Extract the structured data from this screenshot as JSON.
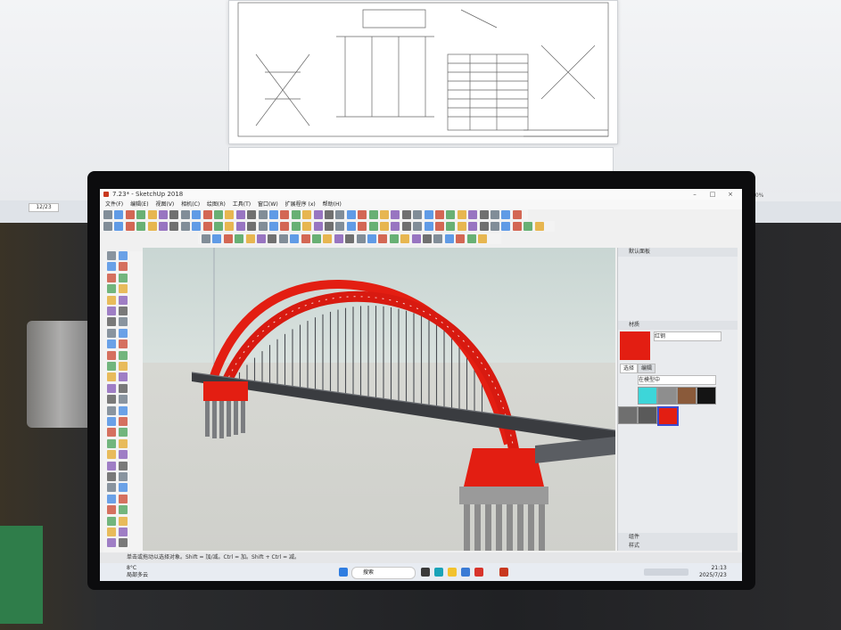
{
  "app": {
    "title": "7.23* - SketchUp 2018",
    "window_controls": [
      "–",
      "□",
      "×"
    ],
    "menus": [
      "文件(F)",
      "编辑(E)",
      "视图(V)",
      "相机(C)",
      "绘图(R)",
      "工具(T)",
      "窗口(W)",
      "扩展程序 (x)",
      "帮助(H)"
    ]
  },
  "tray": {
    "header": "默认面板",
    "entity_title": "材质",
    "material_name": "红钢",
    "tabs": [
      "选择",
      "编辑"
    ],
    "library": "在模型中",
    "sections": [
      "组件",
      "样式"
    ],
    "swatch_colors": [
      "#3dd6d9",
      "#8e8e8e",
      "#8a5a3a",
      "#141414",
      "#6f6f6f",
      "#5a5a5a",
      "#e31e12"
    ],
    "selected_color": "#e31e12"
  },
  "status": {
    "hint": "单击或拖动以选择对象。Shift = 加/减。Ctrl = 加。Shift + Ctrl = 减。"
  },
  "taskbar": {
    "weather_temp": "8°C",
    "weather_desc": "局部多云",
    "search_placeholder": "搜索",
    "time": "21:13",
    "date": "2025/7/23"
  },
  "background": {
    "page_field": "12/23",
    "zoom": "50%"
  },
  "colors": {
    "arch_red": "#e31e12",
    "deck": "#3a3c40",
    "pier": "#8c8c8c"
  }
}
